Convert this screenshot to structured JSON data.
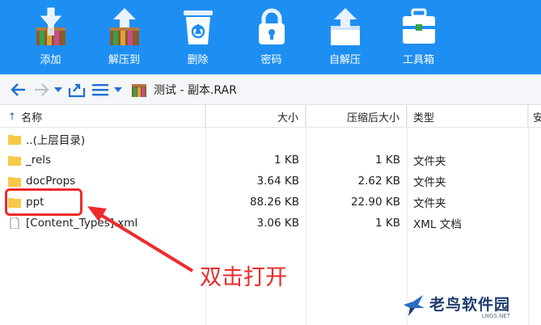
{
  "toolbar": {
    "add": "添加",
    "extract_to": "解压到",
    "delete": "删除",
    "password": "密码",
    "sfx": "自解压",
    "tools": "工具箱"
  },
  "address": {
    "path": "测试 - 副本.RAR"
  },
  "columns": {
    "name": "名称",
    "size": "大小",
    "packed": "压缩后大小",
    "type": "类型",
    "extra": "安"
  },
  "files": [
    {
      "name": "..(上层目录)",
      "size": "",
      "packed": "",
      "type": "",
      "kind": "folder"
    },
    {
      "name": "_rels",
      "size": "1 KB",
      "packed": "1 KB",
      "type": "文件夹",
      "kind": "folder"
    },
    {
      "name": "docProps",
      "size": "3.64 KB",
      "packed": "2.62 KB",
      "type": "文件夹",
      "kind": "folder"
    },
    {
      "name": "ppt",
      "size": "88.26 KB",
      "packed": "22.90 KB",
      "type": "文件夹",
      "kind": "folder"
    },
    {
      "name": "[Content_Types].xml",
      "size": "3.06 KB",
      "packed": "1 KB",
      "type": "XML 文档",
      "kind": "file"
    }
  ],
  "annotation": {
    "text": "双击打开"
  },
  "watermark": {
    "title": "老鸟软件园",
    "sub": "LNGS.NET"
  },
  "colors": {
    "toolbar_bg": "#1e8ff2",
    "annotation": "#ee2b2b",
    "folder": "#f7c948"
  }
}
